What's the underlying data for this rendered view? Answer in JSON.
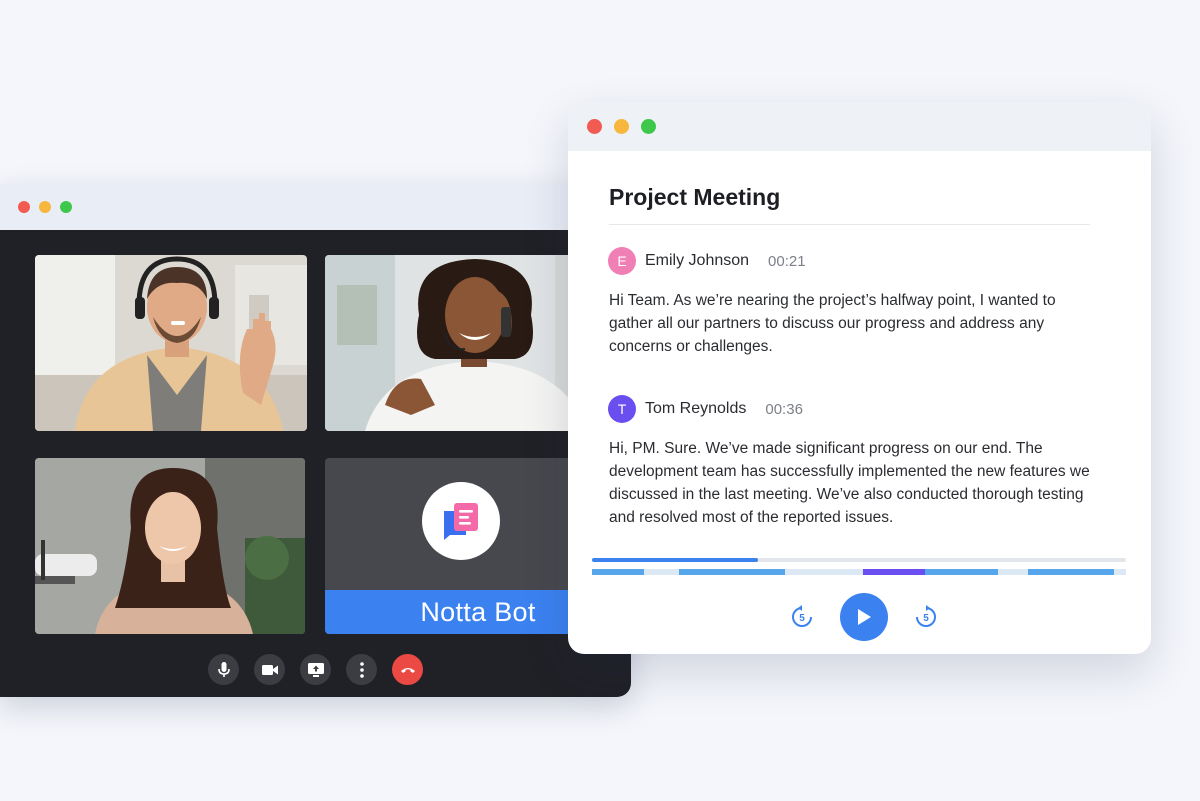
{
  "colors": {
    "traffic_red": "#f25b52",
    "traffic_yellow": "#f6b73c",
    "traffic_green": "#3ec84b",
    "accent_blue": "#3b82f0",
    "end_call_red": "#ea4a43",
    "avatar_emily": "#f07fb5",
    "avatar_tom": "#6b4ef0",
    "segment_purple": "#6b4ef0",
    "segment_blue": "#56a6ec"
  },
  "call": {
    "participants": [
      {
        "name": "Man with headset waving",
        "tile": "video"
      },
      {
        "name": "Woman on phone headset",
        "tile": "video"
      },
      {
        "name": "Woman at microphone",
        "tile": "video"
      }
    ],
    "bot_label": "Notta Bot",
    "controls": [
      "mic-icon",
      "camera-icon",
      "screen-share-icon",
      "more-options-icon",
      "end-call-icon"
    ]
  },
  "transcript": {
    "title": "Project Meeting",
    "entries": [
      {
        "initial": "E",
        "speaker": "Emily Johnson",
        "time": "00:21",
        "text": "Hi Team. As we’re nearing the project’s halfway point, I wanted to gather all our partners to discuss our progress and address any concerns or challenges."
      },
      {
        "initial": "T",
        "speaker": "Tom Reynolds",
        "time": "00:36",
        "text": "Hi, PM. Sure. We’ve made significant progress on our end. The development team has successfully implemented the new features we discussed in the last meeting. We’ve also conducted thorough testing and resolved most of the reported issues."
      }
    ],
    "progress": 0.31,
    "skip_seconds": "5"
  }
}
